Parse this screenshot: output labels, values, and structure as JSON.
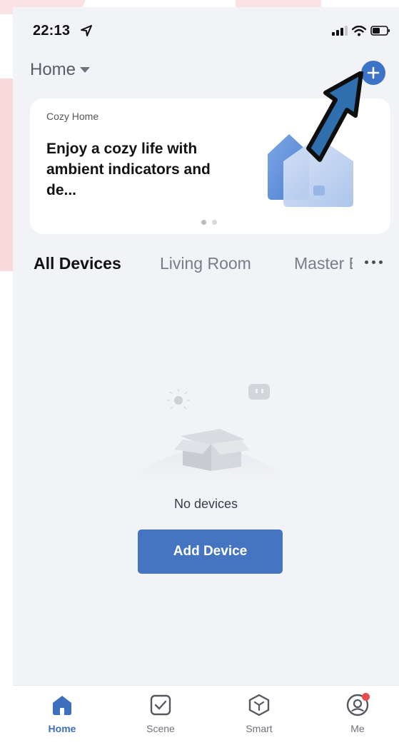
{
  "status_bar": {
    "time": "22:13"
  },
  "header": {
    "home_label": "Home",
    "home_dropdown_icon": "caret-down-icon",
    "add_icon": "plus-circle-icon"
  },
  "banner": {
    "tag": "Cozy Home",
    "text": "Enjoy a cozy life with ambient indicators and de...",
    "page_count": 2,
    "active_page": 1
  },
  "room_tabs": [
    {
      "label": "All Devices",
      "active": true
    },
    {
      "label": "Living Room",
      "active": false
    },
    {
      "label": "Master Bedroom",
      "active": false
    }
  ],
  "empty_state": {
    "message": "No devices",
    "button_label": "Add Device"
  },
  "tab_bar": [
    {
      "label": "Home",
      "icon": "home-icon",
      "active": true
    },
    {
      "label": "Scene",
      "icon": "checkbox-icon",
      "active": false
    },
    {
      "label": "Smart",
      "icon": "cube-icon",
      "active": false
    },
    {
      "label": "Me",
      "icon": "user-icon",
      "active": false,
      "badge": true
    }
  ],
  "colors": {
    "accent": "#3d73c7",
    "background": "#f2f3f7",
    "card": "#ffffff",
    "notification": "#e94b4b"
  }
}
